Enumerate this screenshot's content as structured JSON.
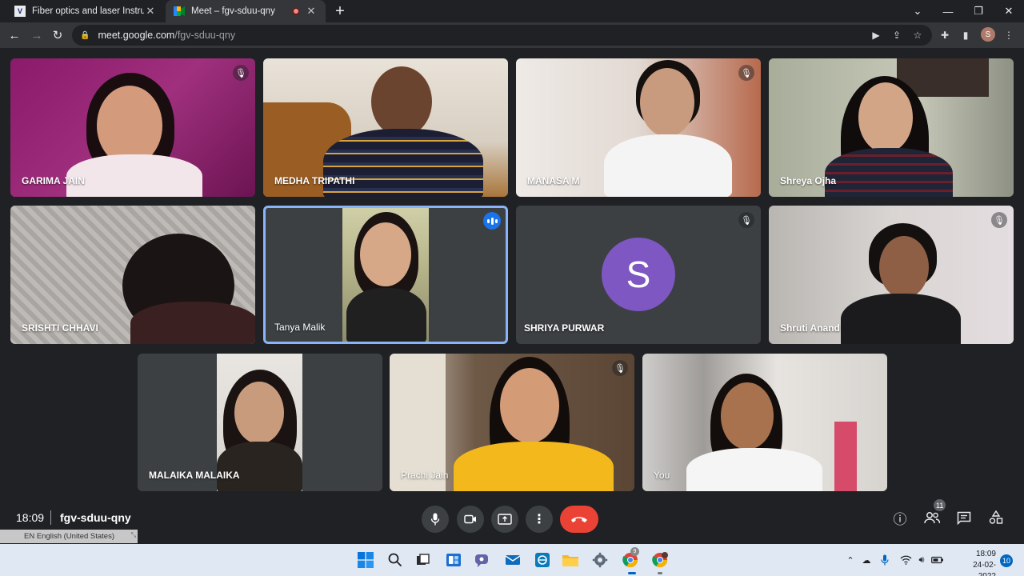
{
  "browser": {
    "tabs": [
      {
        "title": "Fiber optics and laser Instrument",
        "active": false,
        "favicon": "vi-logo-icon"
      },
      {
        "title": "Meet – fgv-sduu-qny",
        "active": true,
        "favicon": "meet-icon"
      }
    ],
    "url_host": "meet.google.com",
    "url_path": "/fgv-sduu-qny",
    "profile_initial": "S"
  },
  "meeting": {
    "participants": [
      {
        "name": "GARIMA JAIN",
        "muted": true
      },
      {
        "name": "MEDHA TRIPATHI",
        "muted": false
      },
      {
        "name": "MANASA M",
        "muted": true
      },
      {
        "name": "Shreya Ojha",
        "muted": false
      },
      {
        "name": "SRISHTI CHHAVI",
        "muted": false
      },
      {
        "name": "Tanya Malik",
        "muted": false,
        "speaking": true
      },
      {
        "name": "SHRIYA PURWAR",
        "muted": true,
        "avatar_initial": "S",
        "avatar_color": "#7e57c2"
      },
      {
        "name": "Shruti Anand",
        "muted": true
      },
      {
        "name": "MALAIKA MALAIKA",
        "muted": false
      },
      {
        "name": "Prachi Jain",
        "muted": true
      },
      {
        "name": "You",
        "muted": false
      }
    ],
    "time": "18:09",
    "code": "fgv-sduu-qny",
    "people_count": "11",
    "end_call_color": "#ea4335",
    "speaking_color": "#8ab4f8"
  },
  "language_bar": "EN English (United States)",
  "taskbar": {
    "time": "18:09",
    "date": "24-02-2022",
    "notification_count": "10",
    "chrome_badge": "9"
  }
}
